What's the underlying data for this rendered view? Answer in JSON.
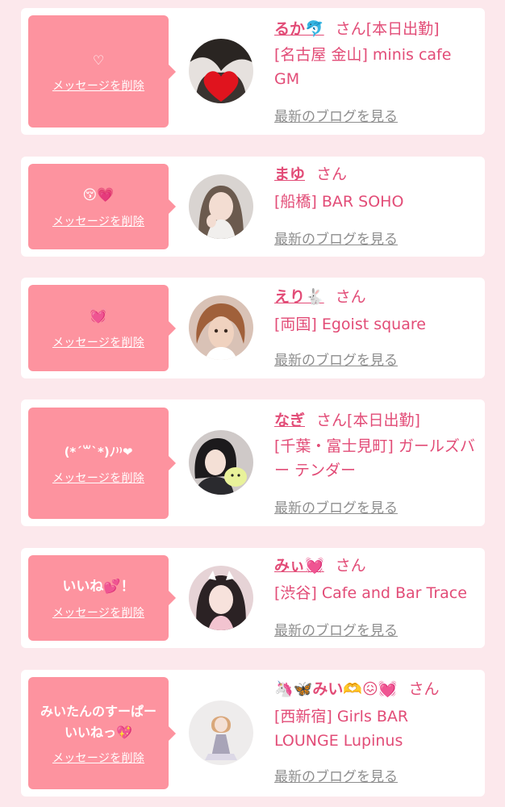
{
  "delete_label": "メッセージを削除",
  "blog_label": "最新のブログを見る",
  "honorific": "さん",
  "items": [
    {
      "message": "♡",
      "name": "るか🐬",
      "badge": "[本日出勤]",
      "shop": "[名古屋 金山] minis cafe GM"
    },
    {
      "message": "😚💗",
      "name": "まゆ",
      "badge": "",
      "shop": "[船橋] BAR SOHO"
    },
    {
      "message": "💓",
      "name": "えり🐇",
      "badge": "",
      "shop": "[両国] Egoist square"
    },
    {
      "message": "(*´꒳`*)ﾉ⁾⁾❤",
      "name": "なぎ",
      "badge": "[本日出勤]",
      "shop": "[千葉・富士見町] ガールズバー テンダー"
    },
    {
      "message": "いいね💕！",
      "name": "みぃ💓",
      "badge": "",
      "shop": "[渋谷] Cafe and Bar Trace"
    },
    {
      "message": "みいたんのすーぱーいいねっ💖",
      "name": "🦄🦋みい🫶😖💓",
      "badge": "",
      "shop": "[西新宿] Girls BAR LOUNGE Lupinus"
    }
  ],
  "colors": {
    "page_background": "#fce8ec",
    "bubble": "#fd939f",
    "accent": "#e24c77",
    "link_gray": "#8e8e8e"
  }
}
